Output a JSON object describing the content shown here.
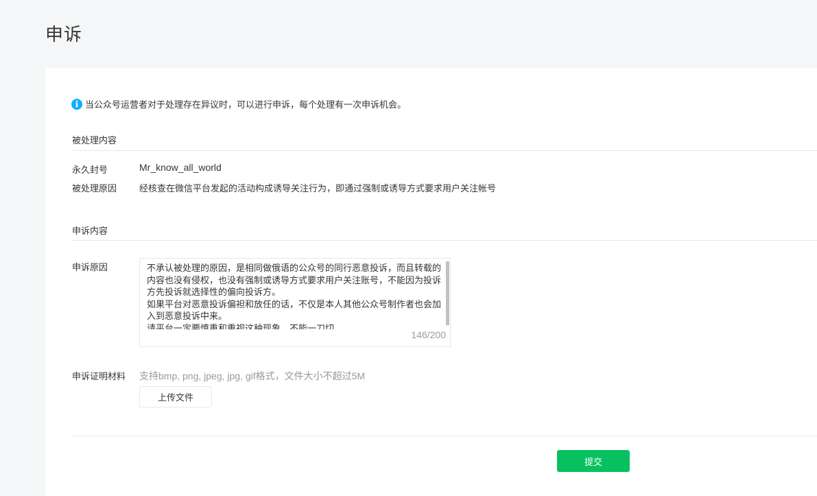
{
  "page": {
    "title": "申诉"
  },
  "notice": {
    "text": "当公众号运营者对于处理存在异议时，可以进行申诉，每个处理有一次申诉机会。"
  },
  "handled_section": {
    "title": "被处理内容",
    "rows": [
      {
        "label": "永久封号",
        "value": "Mr_know_all_world"
      },
      {
        "label": "被处理原因",
        "value": "经核查在微信平台发起的活动构成诱导关注行为，即通过强制或诱导方式要求用户关注帐号"
      }
    ]
  },
  "appeal_section": {
    "title": "申诉内容",
    "reason_label": "申诉原因",
    "reason_text": "不承认被处理的原因，是相同做俄语的公众号的同行恶意投诉，而且转载的内容也没有侵权，也没有强制或诱导方式要求用户关注账号，不能因为投诉方先投诉就选择性的偏向投诉方。\n如果平台对恶意投诉偏袒和放任的话，不仅是本人其他公众号制作者也会加入到恶意投诉中来。\n请平台一定要慎重和重视这种现象，不能一刀切",
    "counter": "146/200",
    "evidence_label": "申诉证明材料",
    "evidence_hint": "支持bmp, png, jpeg, jpg, gif格式，文件大小不超过5M",
    "upload_label": "上传文件"
  },
  "actions": {
    "submit_label": "提交"
  },
  "colors": {
    "primary": "#07c160",
    "info": "#10aeff",
    "background": "#f5f6f7",
    "hint": "#9a9a9a"
  }
}
